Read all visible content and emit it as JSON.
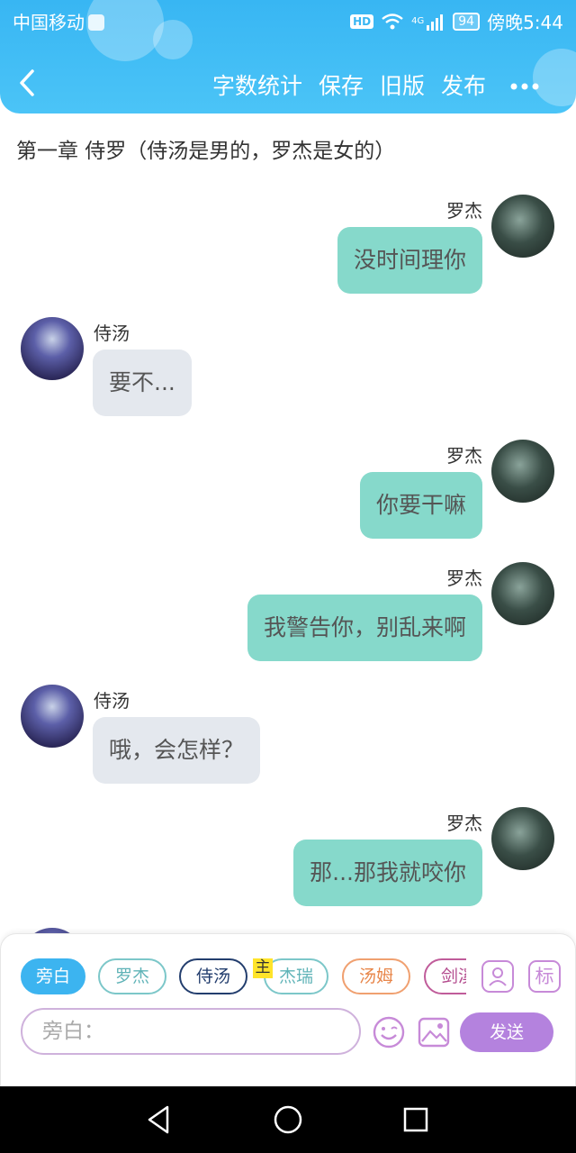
{
  "status_bar": {
    "carrier": "中国移动",
    "network": "4G",
    "battery": "94",
    "time": "傍晚5:44",
    "hd_label": "HD"
  },
  "toolbar": {
    "back_icon": "chevron-left-icon",
    "actions": [
      "字数统计",
      "保存",
      "旧版",
      "发布"
    ],
    "more_icon": "more-dots-icon"
  },
  "chapter": {
    "title": "第一章  侍罗（侍汤是男的，罗杰是女的）"
  },
  "messages": [
    {
      "speaker": "罗杰",
      "side": "right",
      "text": "没时间理你"
    },
    {
      "speaker": "侍汤",
      "side": "left",
      "text": "要不..."
    },
    {
      "speaker": "罗杰",
      "side": "right",
      "text": "你要干嘛"
    },
    {
      "speaker": "罗杰",
      "side": "right",
      "text": "我警告你，别乱来啊"
    },
    {
      "speaker": "侍汤",
      "side": "left",
      "text": "哦，会怎样？"
    },
    {
      "speaker": "罗杰",
      "side": "right",
      "text": "那...那我就咬你"
    }
  ],
  "roles": {
    "items": [
      "旁白",
      "罗杰",
      "侍汤",
      "杰瑞",
      "汤姆",
      "剑溪"
    ],
    "selected": "旁白",
    "main_tag": "主",
    "manage_icon": "contacts-icon",
    "tag_button": "标"
  },
  "composer": {
    "placeholder": "旁白：",
    "emoji_icon": "emoji-icon",
    "image_icon": "image-icon",
    "send_label": "发送"
  },
  "colors": {
    "header": "#38b6f3",
    "right_bubble": "#86d9cb",
    "left_bubble": "#e4e8ee",
    "send_button": "#b482de",
    "selected_chip": "#3cb4f0"
  }
}
